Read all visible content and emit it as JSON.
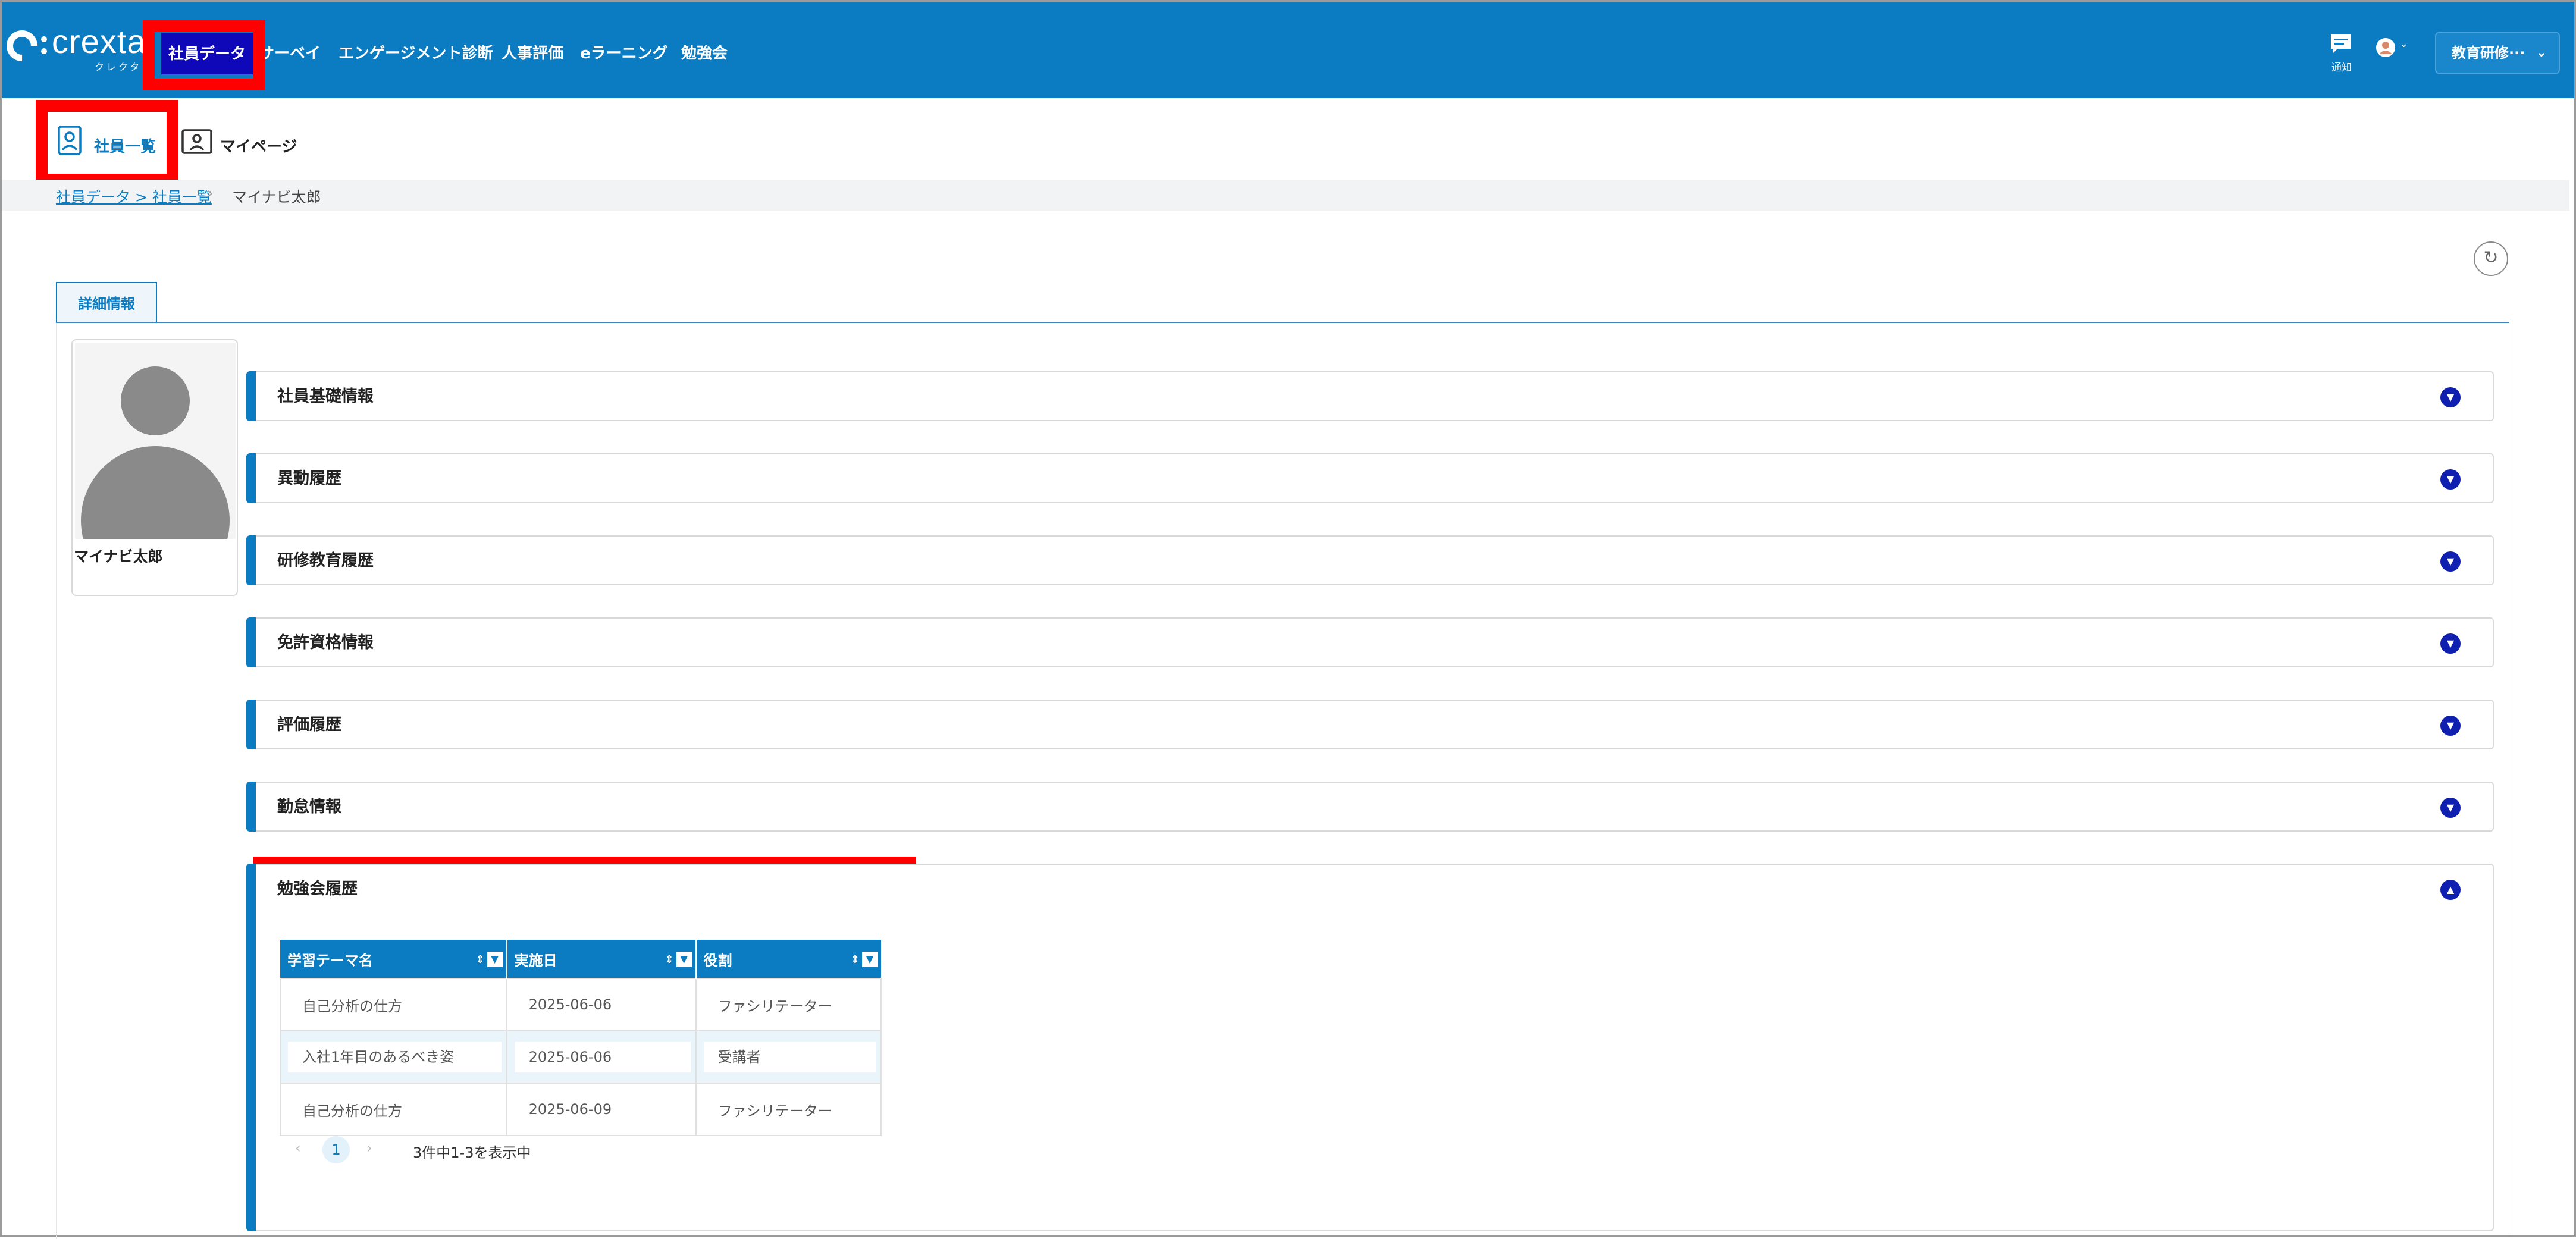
{
  "brand": {
    "name": "crexta",
    "sub": "クレクタ"
  },
  "header": {
    "nav": [
      "社員データ",
      "サーベイ",
      "エンゲージメント診断",
      "人事評価",
      "eラーニング",
      "勉強会"
    ],
    "notification_label": "通知",
    "org_select": "教育研修···",
    "icons": [
      "chat-icon",
      "user-icon",
      "chevron-down-icon"
    ]
  },
  "subnav": {
    "items": [
      "社員一覧",
      "マイページ"
    ]
  },
  "breadcrumb": {
    "link": "社員データ > 社員一覧",
    "current": "マイナビ太郎"
  },
  "tab": {
    "label": "詳細情報"
  },
  "profile": {
    "name": "マイナビ太郎"
  },
  "sections": [
    "社員基礎情報",
    "異動履歴",
    "研修教育履歴",
    "免許資格情報",
    "評価履歴",
    "勤怠情報",
    "勉強会履歴"
  ],
  "study_table": {
    "headers": [
      "学習テーマ名",
      "実施日",
      "役割"
    ],
    "rows": [
      [
        "自己分析の仕方",
        "2025-06-06",
        "ファシリテーター"
      ],
      [
        "入社1年目のあるべき姿",
        "2025-06-06",
        "受講者"
      ],
      [
        "自己分析の仕方",
        "2025-06-09",
        "ファシリテーター"
      ]
    ],
    "pagination": {
      "page": "1",
      "info": "3件中1-3を表示中"
    }
  },
  "colors": {
    "primary": "#0c7cc2",
    "highlight": "#ff0000",
    "active_nav": "#0f08b8"
  }
}
